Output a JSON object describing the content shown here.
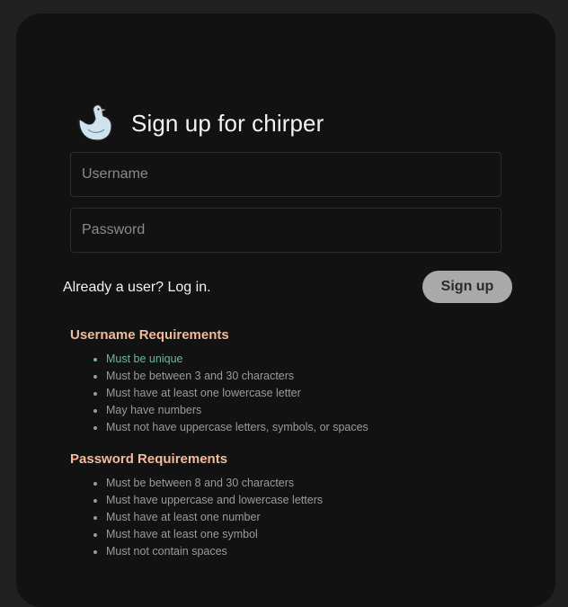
{
  "header": {
    "title": "Sign up for chirper",
    "logo_icon": "duck-logo-icon"
  },
  "form": {
    "username_placeholder": "Username",
    "username_value": "",
    "password_placeholder": "Password",
    "password_value": "",
    "login_link": "Already a user? Log in.",
    "signup_button": "Sign up"
  },
  "username_requirements": {
    "heading": "Username Requirements",
    "items": [
      {
        "text": "Must be unique",
        "met": true
      },
      {
        "text": "Must be between 3 and 30 characters",
        "met": false
      },
      {
        "text": "Must have at least one lowercase letter",
        "met": false
      },
      {
        "text": "May have numbers",
        "met": false
      },
      {
        "text": "Must not have uppercase letters, symbols, or spaces",
        "met": false
      }
    ]
  },
  "password_requirements": {
    "heading": "Password Requirements",
    "items": [
      {
        "text": "Must be between 8 and 30 characters",
        "met": false
      },
      {
        "text": "Must have uppercase and lowercase letters",
        "met": false
      },
      {
        "text": "Must have at least one number",
        "met": false
      },
      {
        "text": "Must have at least one symbol",
        "met": false
      },
      {
        "text": "Must not contain spaces",
        "met": false
      }
    ]
  },
  "colors": {
    "background": "#202020",
    "card": "#121212",
    "heading_accent": "#f3b99b",
    "met_requirement": "#6fb59a",
    "button_bg": "#a9a9a9"
  }
}
